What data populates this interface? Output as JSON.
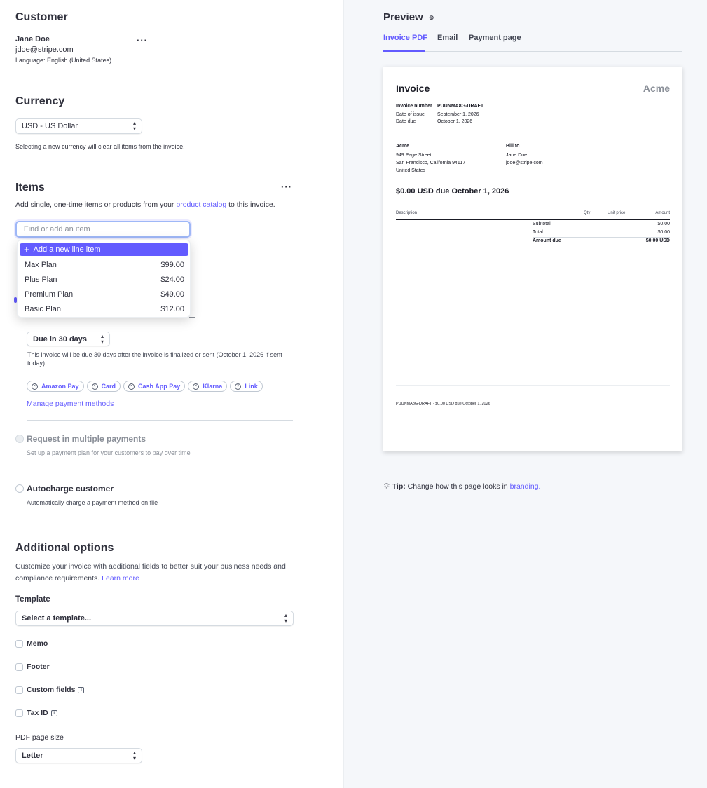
{
  "customer": {
    "heading": "Customer",
    "name": "Jane Doe",
    "email": "jdoe@stripe.com",
    "language": "Language: English (United States)",
    "menu": "···"
  },
  "currency": {
    "heading": "Currency",
    "selected": "USD - US Dollar",
    "help": "Selecting a new currency will clear all items from the invoice."
  },
  "items": {
    "heading": "Items",
    "menu": "···",
    "desc_pre": "Add single, one-time items or products from your ",
    "desc_link": "product catalog",
    "desc_post": " to this invoice.",
    "search_placeholder": "Find or add an item",
    "add_new": "Add a new line item",
    "products": [
      {
        "name": "Max Plan",
        "price": "$99.00"
      },
      {
        "name": "Plus Plan",
        "price": "$24.00"
      },
      {
        "name": "Premium Plan",
        "price": "$49.00"
      },
      {
        "name": "Basic Plan",
        "price": "$12.00"
      }
    ]
  },
  "payment": {
    "due_selected": "Due in 30 days",
    "due_help": "This invoice will be due 30 days after the invoice is finalized or sent (October 1, 2026 if sent today).",
    "methods": [
      "Amazon Pay",
      "Card",
      "Cash App Pay",
      "Klarna",
      "Link"
    ],
    "manage_link": "Manage payment methods",
    "multiple_title": "Request in multiple payments",
    "multiple_desc": "Set up a payment plan for your customers to pay over time",
    "autocharge_title": "Autocharge customer",
    "autocharge_desc": "Automatically charge a payment method on file"
  },
  "additional": {
    "heading": "Additional options",
    "desc": "Customize your invoice with additional fields to better suit your business needs and compliance requirements.",
    "learn_more": "Learn more",
    "template_label": "Template",
    "template_placeholder": "Select a template...",
    "memo": "Memo",
    "footer": "Footer",
    "custom_fields": "Custom fields",
    "tax_id": "Tax ID",
    "pdf_label": "PDF page size",
    "pdf_selected": "Letter"
  },
  "preview": {
    "heading": "Preview",
    "tabs": [
      "Invoice PDF",
      "Email",
      "Payment page"
    ],
    "active_tab": 0,
    "tip_label": "Tip:",
    "tip_text": " Change how this page looks in ",
    "tip_link": "branding."
  },
  "invoice": {
    "title": "Invoice",
    "brand": "Acme",
    "number_label": "Invoice number",
    "number": "PUUNMA8G-DRAFT",
    "issue_label": "Date of issue",
    "issue": "September 1, 2026",
    "due_label": "Date due",
    "due": "October 1, 2026",
    "from_name": "Acme",
    "from_line1": "949 Page Street",
    "from_line2": "San Francisco, California 94117",
    "from_line3": "United States",
    "billto_label": "Bill to",
    "billto_name": "Jane Doe",
    "billto_email": "jdoe@stripe.com",
    "amount_due_headline": "$0.00 USD due October 1, 2026",
    "col_description": "Description",
    "col_qty": "Qty",
    "col_unit": "Unit price",
    "col_amount": "Amount",
    "subtotal_label": "Subtotal",
    "subtotal": "$0.00",
    "total_label": "Total",
    "total": "$0.00",
    "amount_due_label": "Amount due",
    "amount_due": "$0.00 USD",
    "footer_text": "PUUNMA8G-DRAFT · $0.00 USD due October 1, 2026"
  }
}
